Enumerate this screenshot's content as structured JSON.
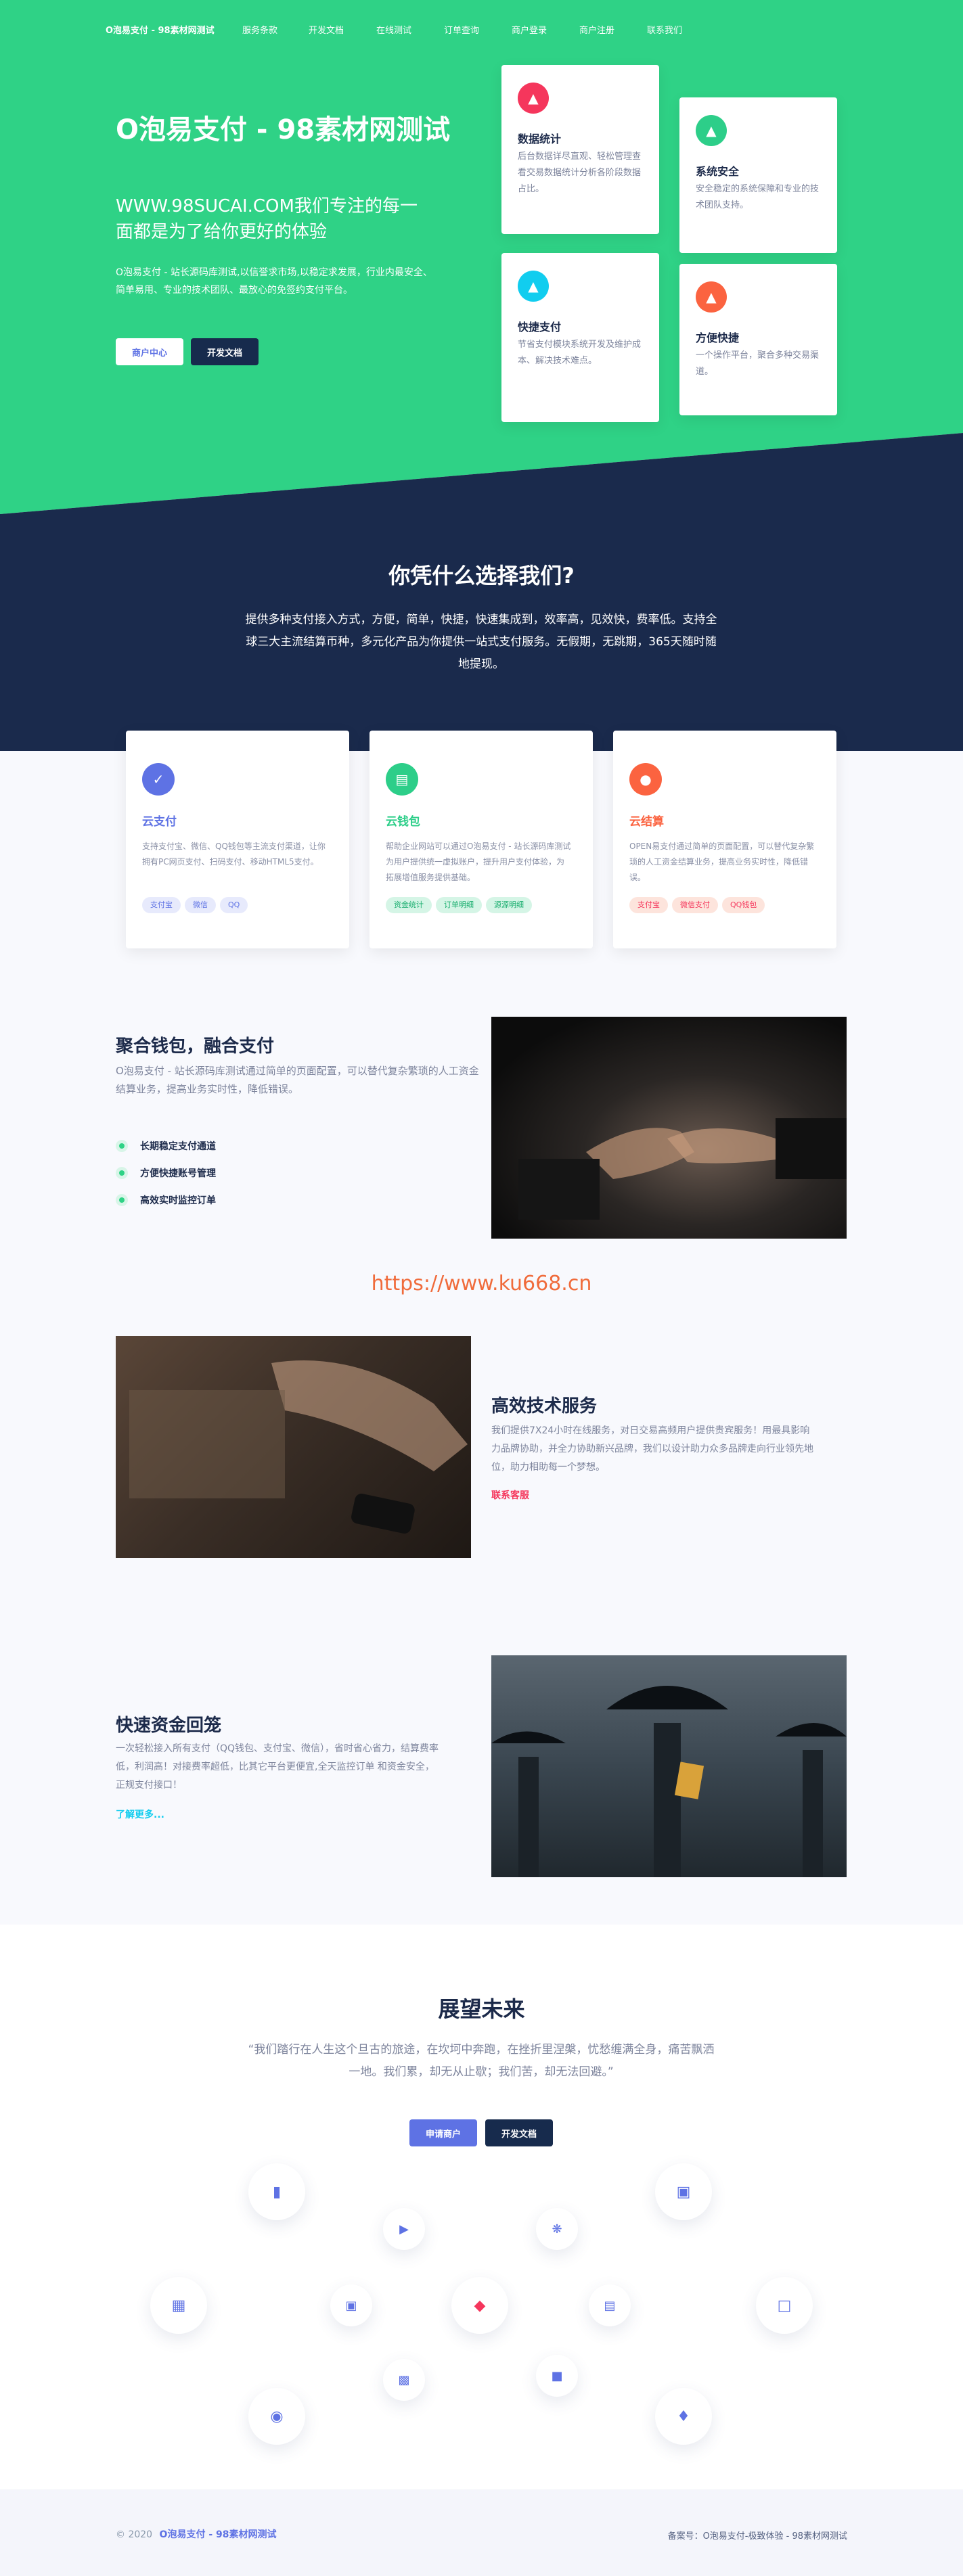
{
  "nav": {
    "brand": "O泡易支付 - 98素材网测试",
    "links": [
      "服务条款",
      "开发文档",
      "在线测试",
      "订单查询",
      "商户登录",
      "商户注册",
      "联系我们"
    ]
  },
  "hero": {
    "title": "O泡易支付 - 98素材网测试",
    "subtitle": "WWW.98SUCAI.COM我们专注的每一面都是为了给你更好的体验",
    "desc": "O泡易支付 - 站长源码库测试,以信誉求市场,以稳定求发展，行业内最安全、简单易用、专业的技术团队、最放心的免签约支付平台。",
    "btn_merchant": "商户中心",
    "btn_docs": "开发文档"
  },
  "features": [
    {
      "title": "数据统计",
      "desc": "后台数据详尽直观、轻松管理查看交易数据统计分析各阶段数据占比。",
      "icon": "thumb-up-icon",
      "color": "#f5365c"
    },
    {
      "title": "系统安全",
      "desc": "安全稳定的系统保障和专业的技术团队支持。",
      "icon": "thumb-up-icon",
      "color": "#2dce89"
    },
    {
      "title": "快捷支付",
      "desc": "节省支付模块系统开发及维护成本、解决技术难点。",
      "icon": "thumb-up-icon",
      "color": "#11cdef"
    },
    {
      "title": "方便快捷",
      "desc": "一个操作平台，聚合多种交易渠道。",
      "icon": "thumb-up-icon",
      "color": "#fb6340"
    }
  ],
  "why": {
    "title": "你凭什么选择我们?",
    "desc": "提供多种支付接入方式，方便，简单，快捷，快速集成到，效率高，见效快，费率低。支持全球三大主流结算币种，多元化产品为你提供一站式支付服务。无假期，无跳期，365天随时随地提现。"
  },
  "cards": [
    {
      "title": "云支付",
      "desc": "支持支付宝、微信、QQ钱包等主流支付渠道，让你拥有PC网页支付、扫码支付、移动HTML5支付。",
      "tags": [
        "支付宝",
        "微信",
        "QQ"
      ],
      "color": "#5e72e4",
      "tag_bg": "#e7eafc",
      "tag_fg": "#5e72e4"
    },
    {
      "title": "云钱包",
      "desc": "帮助企业网站可以通过O泡易支付 - 站长源码库测试为用户提供统一虚拟账户，提升用户支付体验，为拓展增值服务提供基础。",
      "tags": [
        "资金统计",
        "订单明细",
        "源源明细"
      ],
      "color": "#2dce89",
      "tag_bg": "#d5f5e6",
      "tag_fg": "#1aae6f"
    },
    {
      "title": "云结算",
      "desc": "OPEN易支付通过简单的页面配置，可以替代复杂繁琐的人工资金结算业务，提高业务实时性，降低错误。",
      "tags": [
        "支付宝",
        "微信支付",
        "QQ钱包"
      ],
      "color": "#fb6340",
      "tag_bg": "#fde4dc",
      "tag_fg": "#f5365c"
    }
  ],
  "wallet": {
    "title": "聚合钱包，融合支付",
    "desc": "O泡易支付 - 站长源码库测试通过简单的页面配置，可以替代复杂繁琐的人工资金结算业务，提高业务实时性，降低错误。",
    "items": [
      "长期稳定支付通道",
      "方便快捷账号管理",
      "高效实时监控订单"
    ]
  },
  "watermark": "https://www.ku668.cn",
  "tech": {
    "title": "高效技术服务",
    "desc": "我们提供7X24小时在线服务，对日交易高频用户提供贵宾服务！用最具影响力品牌协助，并全力协助新兴品牌，我们以设计助力众多品牌走向行业领先地位，助力相助每一个梦想。",
    "link": "联系客服"
  },
  "funds": {
    "title": "快速资金回笼",
    "desc": "一次轻松接入所有支付（QQ钱包、支付宝、微信），省时省心省力，结算费率低，利润高！对接费率超低，比其它平台更便宜,全天监控订单 和资金安全，正规支付接口！",
    "link": "了解更多..."
  },
  "future": {
    "title": "展望未来",
    "quote": "“我们踏行在人生这个旦古的旅途，在坎坷中奔跑，在挫折里涅槃，忧愁缠满全身，痛苦飘洒一地。我们累，却无从止歇；我们苦，却无法回避。”",
    "btn_apply": "申请商户",
    "btn_docs": "开发文档"
  },
  "float_icons": [
    "chart-bar-icon",
    "credit-card-icon",
    "play-icon",
    "atom-icon",
    "calendar-icon",
    "briefcase-icon",
    "diamond-icon",
    "image-icon",
    "cart-icon",
    "building-icon",
    "cube-icon",
    "camera-icon",
    "bell-icon"
  ],
  "footer": {
    "copyright_prefix": "© 2020",
    "copyright_link": "O泡易支付 - 98素材网测试",
    "icp": "备案号：O泡易支付-极致体验 - 98素材网测试"
  }
}
